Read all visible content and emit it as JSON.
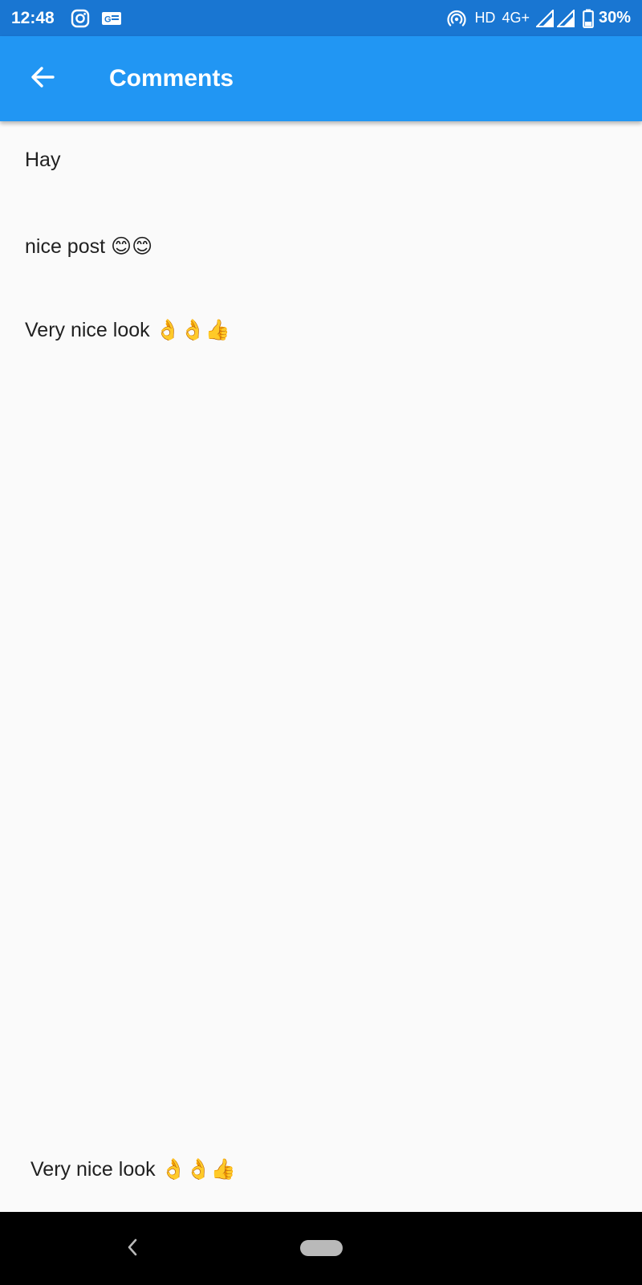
{
  "status_bar": {
    "time": "12:48",
    "network_label": "HD",
    "signal_label": "4G+",
    "battery": "30%",
    "icons": [
      "instagram-icon",
      "notification-card-icon",
      "hotspot-icon",
      "signal-icon",
      "signal-icon",
      "battery-icon"
    ]
  },
  "app_bar": {
    "title": "Comments",
    "back_icon": "arrow-back-icon",
    "background_color": "#2196f3"
  },
  "comments": [
    {
      "text": "Hay"
    },
    {
      "text": "nice post 😊😊"
    },
    {
      "text": "Very nice look 👌👌👍"
    }
  ],
  "input": {
    "value": "Very nice look 👌👌👍"
  },
  "nav_bar": {
    "back_icon": "nav-back-icon",
    "home_icon": "home-pill-icon"
  },
  "colors": {
    "status_bar": "#1976d2",
    "app_bar": "#2196f3",
    "background": "#fafafa",
    "nav_bar": "#000000"
  }
}
